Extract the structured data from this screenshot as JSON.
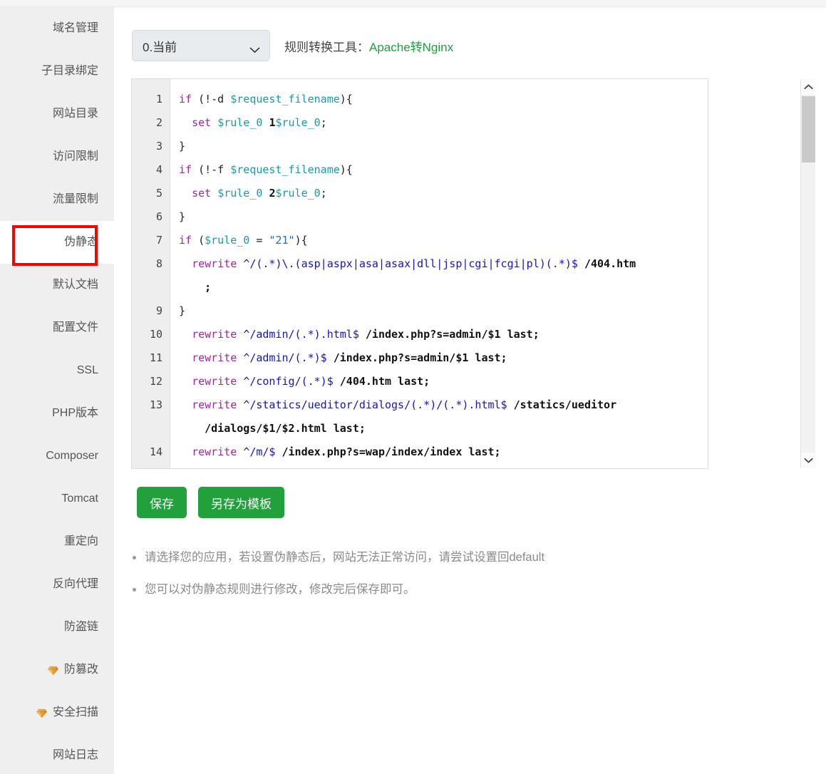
{
  "sidebar": {
    "items": [
      {
        "label": "域名管理",
        "icon": null,
        "active": false
      },
      {
        "label": "子目录绑定",
        "icon": null,
        "active": false
      },
      {
        "label": "网站目录",
        "icon": null,
        "active": false
      },
      {
        "label": "访问限制",
        "icon": null,
        "active": false
      },
      {
        "label": "流量限制",
        "icon": null,
        "active": false
      },
      {
        "label": "伪静态",
        "icon": null,
        "active": true
      },
      {
        "label": "默认文档",
        "icon": null,
        "active": false
      },
      {
        "label": "配置文件",
        "icon": null,
        "active": false
      },
      {
        "label": "SSL",
        "icon": null,
        "active": false
      },
      {
        "label": "PHP版本",
        "icon": null,
        "active": false
      },
      {
        "label": "Composer",
        "icon": null,
        "active": false
      },
      {
        "label": "Tomcat",
        "icon": null,
        "active": false
      },
      {
        "label": "重定向",
        "icon": null,
        "active": false
      },
      {
        "label": "反向代理",
        "icon": null,
        "active": false
      },
      {
        "label": "防盗链",
        "icon": null,
        "active": false
      },
      {
        "label": "防篡改",
        "icon": "gem-icon",
        "active": false
      },
      {
        "label": "安全扫描",
        "icon": "gem-icon",
        "active": false
      },
      {
        "label": "网站日志",
        "icon": null,
        "active": false
      }
    ]
  },
  "toolbar": {
    "template_select_value": "0.当前",
    "converter_label": "规则转换工具：",
    "converter_link": "Apache转Nginx"
  },
  "editor": {
    "line_numbers": [
      "1",
      "2",
      "3",
      "4",
      "5",
      "6",
      "7",
      "8",
      "",
      "9",
      "10",
      "11",
      "12",
      "13",
      "",
      "14"
    ],
    "lines": [
      {
        "num": "1",
        "tokens": [
          {
            "t": "if",
            "c": "k"
          },
          {
            "t": " (!-d ",
            "c": "p"
          },
          {
            "t": "$request_filename",
            "c": "v"
          },
          {
            "t": "){",
            "c": "p"
          }
        ]
      },
      {
        "num": "2",
        "tokens": [
          {
            "t": "  ",
            "c": "p"
          },
          {
            "t": "set",
            "c": "k"
          },
          {
            "t": " ",
            "c": "p"
          },
          {
            "t": "$rule_0",
            "c": "v"
          },
          {
            "t": " ",
            "c": "p"
          },
          {
            "t": "1",
            "c": "n"
          },
          {
            "t": "$rule_0",
            "c": "v"
          },
          {
            "t": ";",
            "c": "p"
          }
        ]
      },
      {
        "num": "3",
        "tokens": [
          {
            "t": "}",
            "c": "p"
          }
        ]
      },
      {
        "num": "4",
        "tokens": [
          {
            "t": "if",
            "c": "k"
          },
          {
            "t": " (!-f ",
            "c": "p"
          },
          {
            "t": "$request_filename",
            "c": "v"
          },
          {
            "t": "){",
            "c": "p"
          }
        ]
      },
      {
        "num": "5",
        "tokens": [
          {
            "t": "  ",
            "c": "p"
          },
          {
            "t": "set",
            "c": "k"
          },
          {
            "t": " ",
            "c": "p"
          },
          {
            "t": "$rule_0",
            "c": "v"
          },
          {
            "t": " ",
            "c": "p"
          },
          {
            "t": "2",
            "c": "n"
          },
          {
            "t": "$rule_0",
            "c": "v"
          },
          {
            "t": ";",
            "c": "p"
          }
        ]
      },
      {
        "num": "6",
        "tokens": [
          {
            "t": "}",
            "c": "p"
          }
        ]
      },
      {
        "num": "7",
        "tokens": [
          {
            "t": "if",
            "c": "k"
          },
          {
            "t": " (",
            "c": "p"
          },
          {
            "t": "$rule_0",
            "c": "v"
          },
          {
            "t": " = ",
            "c": "p"
          },
          {
            "t": "\"21\"",
            "c": "s"
          },
          {
            "t": "){",
            "c": "p"
          }
        ]
      },
      {
        "num": "8",
        "tokens": [
          {
            "t": "  ",
            "c": "p"
          },
          {
            "t": "rewrite",
            "c": "k"
          },
          {
            "t": " ",
            "c": "p"
          },
          {
            "t": "^/(.*)\\.(asp|aspx|asa|asax|dll|jsp|cgi|fcgi|pl)(.*)$",
            "c": "rx"
          },
          {
            "t": " ",
            "c": "p"
          },
          {
            "t": "/404.htm",
            "c": "n"
          }
        ]
      },
      {
        "num": "",
        "tokens": [
          {
            "t": "    ;",
            "c": "n"
          }
        ]
      },
      {
        "num": "9",
        "tokens": [
          {
            "t": "}",
            "c": "p"
          }
        ]
      },
      {
        "num": "10",
        "tokens": [
          {
            "t": "  ",
            "c": "p"
          },
          {
            "t": "rewrite",
            "c": "k"
          },
          {
            "t": " ",
            "c": "p"
          },
          {
            "t": "^/admin/(.*).html$",
            "c": "rx"
          },
          {
            "t": " ",
            "c": "p"
          },
          {
            "t": "/index.php?s=admin/$1 last;",
            "c": "n"
          }
        ]
      },
      {
        "num": "11",
        "tokens": [
          {
            "t": "  ",
            "c": "p"
          },
          {
            "t": "rewrite",
            "c": "k"
          },
          {
            "t": " ",
            "c": "p"
          },
          {
            "t": "^/admin/(.*)$",
            "c": "rx"
          },
          {
            "t": " ",
            "c": "p"
          },
          {
            "t": "/index.php?s=admin/$1 last;",
            "c": "n"
          }
        ]
      },
      {
        "num": "12",
        "tokens": [
          {
            "t": "  ",
            "c": "p"
          },
          {
            "t": "rewrite",
            "c": "k"
          },
          {
            "t": " ",
            "c": "p"
          },
          {
            "t": "^/config/(.*)$",
            "c": "rx"
          },
          {
            "t": " ",
            "c": "p"
          },
          {
            "t": "/404.htm last;",
            "c": "n"
          }
        ]
      },
      {
        "num": "13",
        "tokens": [
          {
            "t": "  ",
            "c": "p"
          },
          {
            "t": "rewrite",
            "c": "k"
          },
          {
            "t": " ",
            "c": "p"
          },
          {
            "t": "^/statics/ueditor/dialogs/(.*)/(.*).html$",
            "c": "rx"
          },
          {
            "t": " ",
            "c": "p"
          },
          {
            "t": "/statics/ueditor",
            "c": "n"
          }
        ]
      },
      {
        "num": "",
        "tokens": [
          {
            "t": "    /dialogs/$1/$2.html last;",
            "c": "n"
          }
        ]
      },
      {
        "num": "14",
        "tokens": [
          {
            "t": "  ",
            "c": "p"
          },
          {
            "t": "rewrite",
            "c": "k"
          },
          {
            "t": " ",
            "c": "p"
          },
          {
            "t": "^/m/$",
            "c": "rx"
          },
          {
            "t": " ",
            "c": "p"
          },
          {
            "t": "/index.php?s=wap/index/index last;",
            "c": "n"
          }
        ]
      }
    ],
    "plain_text": "if (!-d $request_filename){\n  set $rule_0 1$rule_0;\n}\nif (!-f $request_filename){\n  set $rule_0 2$rule_0;\n}\nif ($rule_0 = \"21\"){\n  rewrite ^/(.*)\\.(asp|aspx|asa|asax|dll|jsp|cgi|fcgi|pl)(.*)$ /404.htm;\n}\n  rewrite ^/admin/(.*).html$ /index.php?s=admin/$1 last;\n  rewrite ^/admin/(.*)$ /index.php?s=admin/$1 last;\n  rewrite ^/config/(.*)$ /404.htm last;\n  rewrite ^/statics/ueditor/dialogs/(.*)/(.*).html$ /statics/ueditor/dialogs/$1/$2.html last;\n  rewrite ^/m/$ /index.php?s=wap/index/index last;"
  },
  "actions": {
    "save_label": "保存",
    "save_as_template_label": "另存为模板"
  },
  "notes": [
    "请选择您的应用，若设置伪静态后，网站无法正常访问，请尝试设置回default",
    "您可以对伪静态规则进行修改，修改完后保存即可。"
  ],
  "colors": {
    "accent_green": "#21a03c",
    "link_green": "#20a03f",
    "annotation_red": "#ff0000",
    "sidebar_bg": "#efefef",
    "gem_gold": "#e8a33d"
  }
}
